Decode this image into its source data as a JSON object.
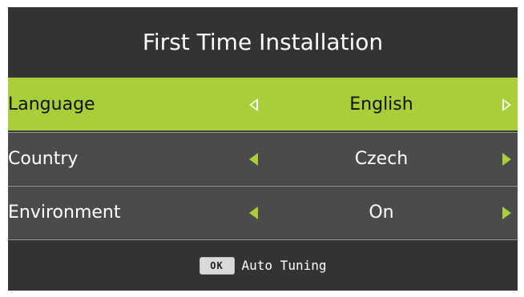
{
  "header": {
    "title": "First Time Installation"
  },
  "menu": {
    "items": [
      {
        "label": "Language",
        "value": "English",
        "selected": true
      },
      {
        "label": "Country",
        "value": "Czech",
        "selected": false
      },
      {
        "label": "Environment",
        "value": "On",
        "selected": false
      }
    ]
  },
  "footer": {
    "key_label": "OK",
    "action_text": "Auto Tuning"
  },
  "colors": {
    "highlight": "#a8cf3a",
    "background": "#4b4b4b",
    "header_background": "#333333",
    "text": "#ffffff"
  },
  "icons": {
    "left": "triangle-left-icon",
    "right": "triangle-right-icon"
  }
}
